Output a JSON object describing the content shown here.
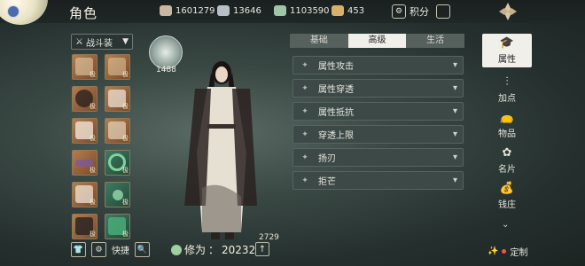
{
  "header": {
    "title": "角色",
    "currencies": [
      {
        "icon": "spirit-coin-icon",
        "value": "1601279",
        "color": "#c9b7a2"
      },
      {
        "icon": "silver-ingot-icon",
        "value": "13646",
        "color": "#b7c0c4"
      },
      {
        "icon": "jade-stone-icon",
        "value": "1103590",
        "color": "#9fc4a8"
      },
      {
        "icon": "gold-coin-icon",
        "value": "453",
        "color": "#d8b06a"
      }
    ],
    "points_label": "积分"
  },
  "outfit": {
    "label": "战斗装",
    "icon": "sword-icon"
  },
  "equipment_slots": [
    {
      "tag": "极",
      "color": "orange",
      "icon": "weapon-icon"
    },
    {
      "tag": "极",
      "color": "orange",
      "icon": "hat-icon"
    },
    {
      "tag": "极",
      "color": "orange",
      "icon": "hair-icon"
    },
    {
      "tag": "极",
      "color": "orange",
      "icon": "cape-icon"
    },
    {
      "tag": "极",
      "color": "orange",
      "icon": "robe-icon"
    },
    {
      "tag": "极",
      "color": "orange",
      "icon": "sleeve-icon"
    },
    {
      "tag": "极",
      "color": "orange",
      "icon": "belt-icon"
    },
    {
      "tag": "极",
      "color": "green",
      "icon": "bracelet-icon"
    },
    {
      "tag": "极",
      "color": "orange",
      "icon": "pants-icon"
    },
    {
      "tag": "极",
      "color": "green",
      "icon": "pendant-icon"
    },
    {
      "tag": "极",
      "color": "orange",
      "icon": "boots-icon"
    },
    {
      "tag": "极",
      "color": "green",
      "icon": "jade-icon"
    }
  ],
  "character": {
    "level": "1488",
    "combat_number": "2729"
  },
  "bottom": {
    "shortcut_label": "快捷",
    "cultivation_label": "修为",
    "cultivation_value": "20232"
  },
  "tabs": [
    {
      "label": "基础",
      "active": false
    },
    {
      "label": "高级",
      "active": true
    },
    {
      "label": "生活",
      "active": false
    }
  ],
  "attributes": [
    {
      "label": "属性攻击"
    },
    {
      "label": "属性穿透"
    },
    {
      "label": "属性抵抗"
    },
    {
      "label": "穿透上限"
    },
    {
      "label": "扬刃"
    },
    {
      "label": "拒芒"
    }
  ],
  "sidebar": [
    {
      "label": "属性",
      "icon": "scholar-hat-icon",
      "active": true
    },
    {
      "label": "加点",
      "icon": "sliders-icon",
      "active": false
    },
    {
      "label": "物品",
      "icon": "bag-icon",
      "active": false
    },
    {
      "label": "名片",
      "icon": "card-icon",
      "active": false
    },
    {
      "label": "钱庄",
      "icon": "money-bag-icon",
      "active": false
    }
  ],
  "customize_label": "定制"
}
